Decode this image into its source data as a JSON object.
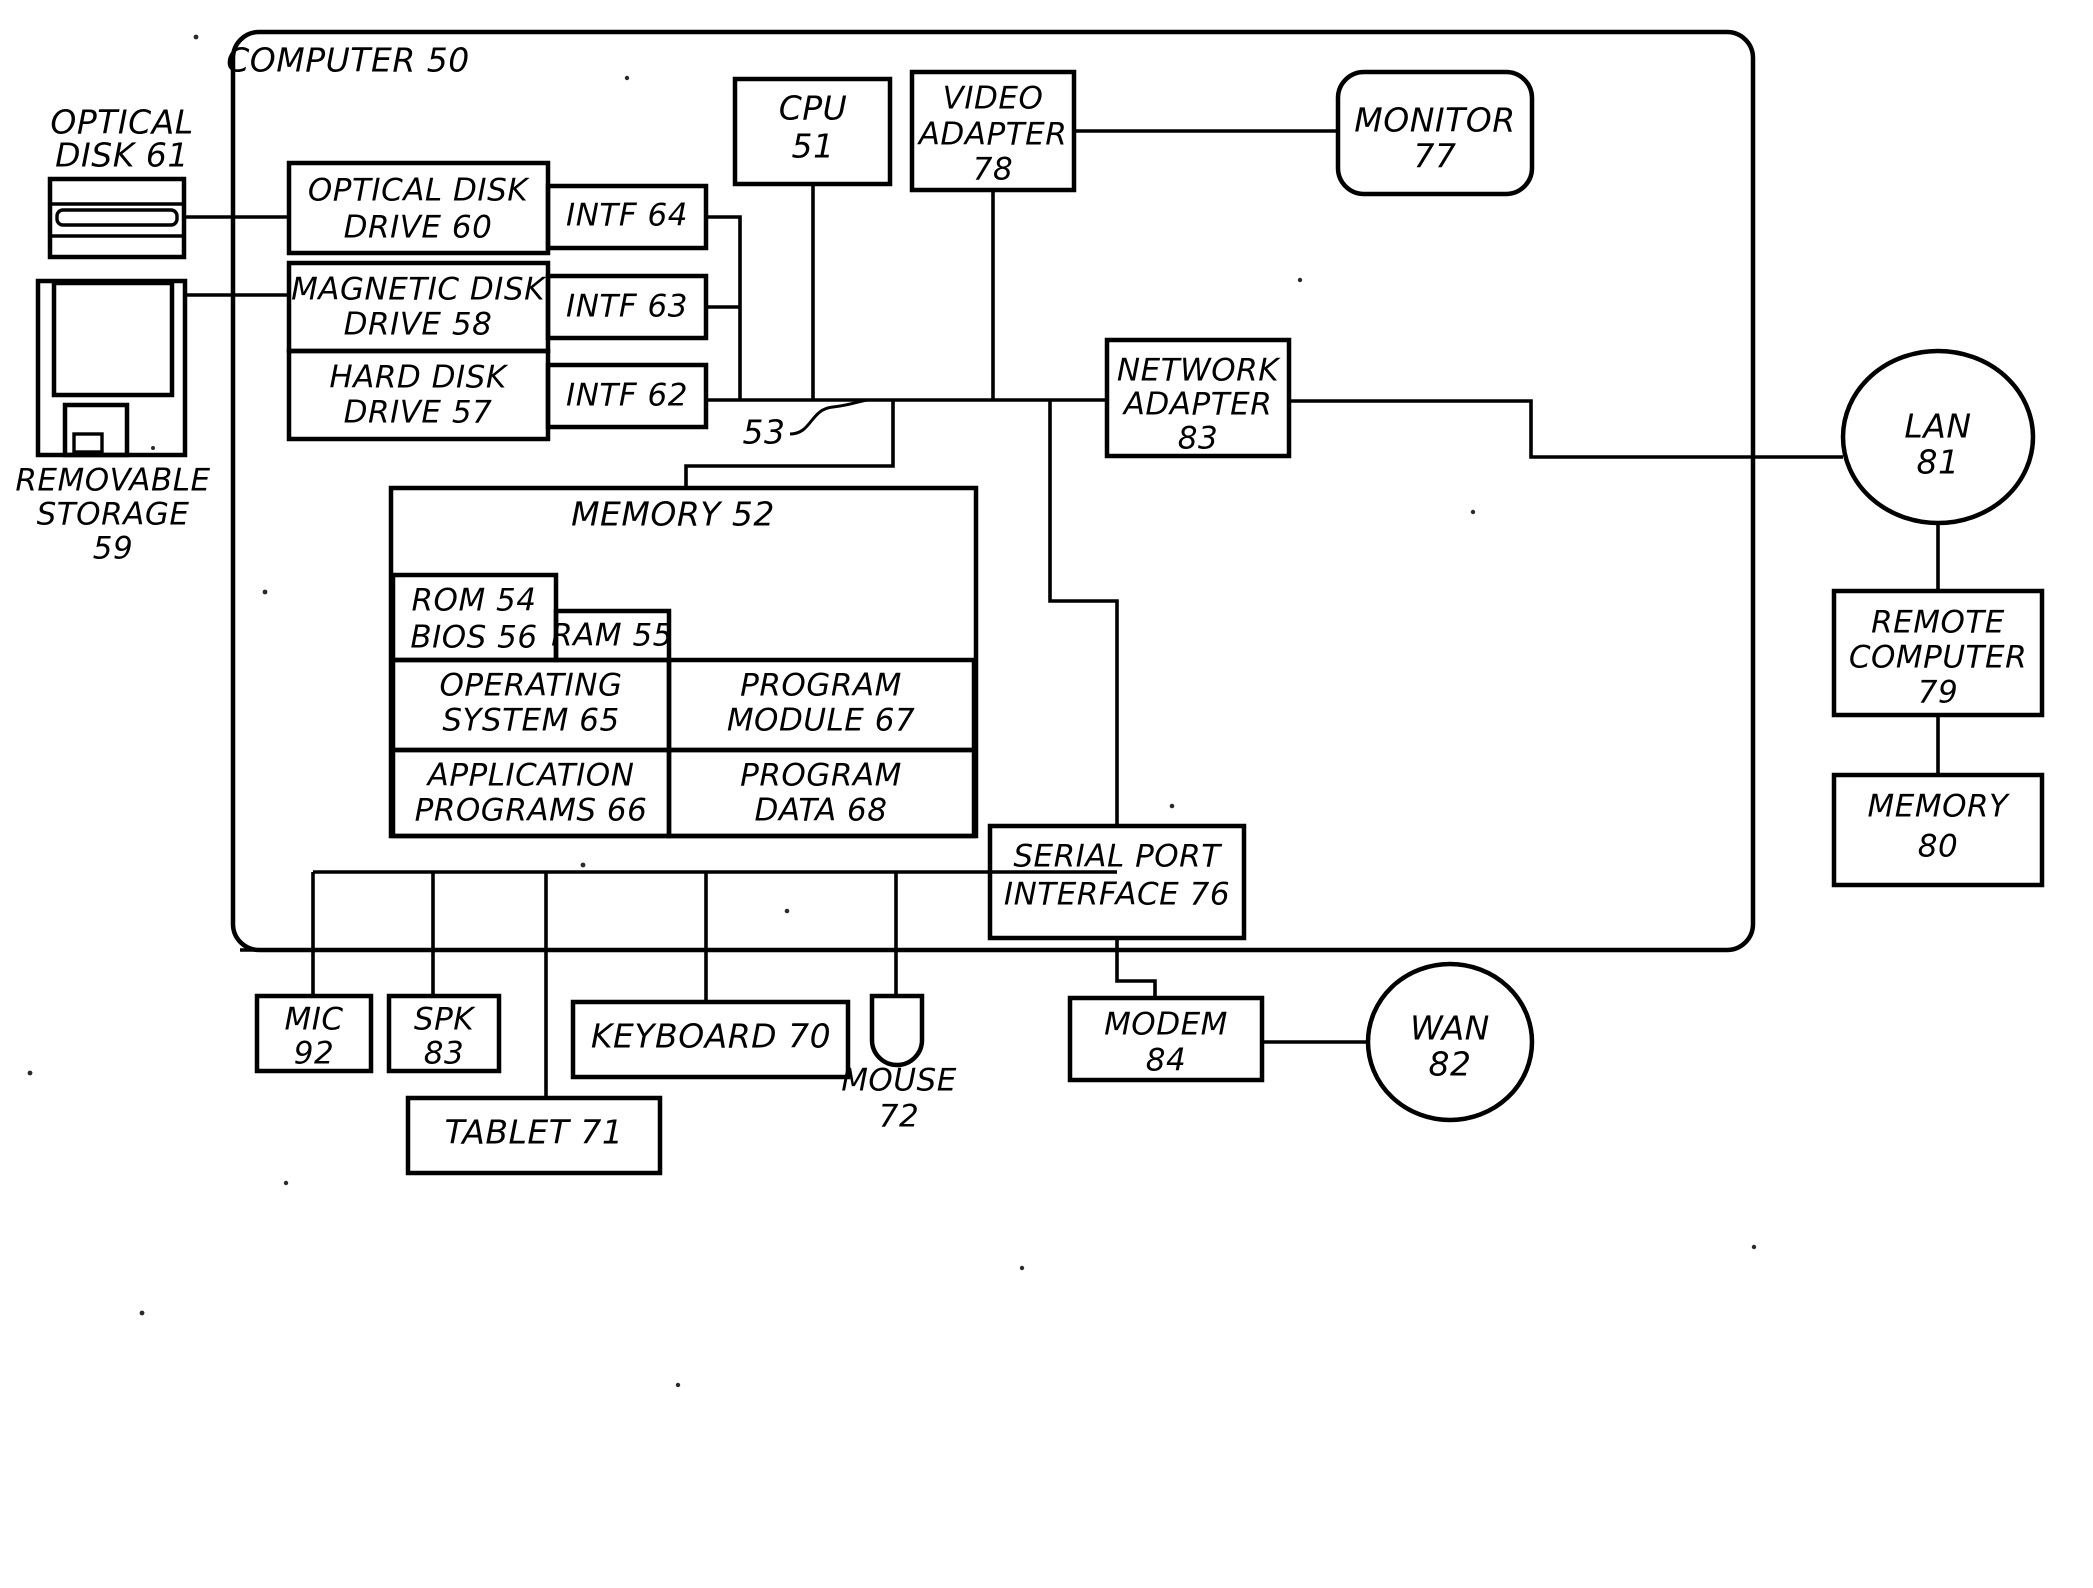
{
  "diagram": {
    "title": "Computer system block diagram",
    "outer_label": "COMPUTER 50",
    "bus_label": "53",
    "blocks": {
      "optical_disk": "OPTICAL\nDISK 61",
      "optical_disk_l1": "OPTICAL",
      "optical_disk_l2": "DISK 61",
      "removable_storage_l1": "REMOVABLE",
      "removable_storage_l2": "STORAGE",
      "removable_storage_l3": "59",
      "optical_disk_drive_l1": "OPTICAL DISK",
      "optical_disk_drive_l2": "DRIVE 60",
      "magnetic_disk_drive_l1": "MAGNETIC DISK",
      "magnetic_disk_drive_l2": "DRIVE 58",
      "hard_disk_drive_l1": "HARD DISK",
      "hard_disk_drive_l2": "DRIVE 57",
      "intf64": "INTF 64",
      "intf63": "INTF 63",
      "intf62": "INTF 62",
      "cpu_l1": "CPU",
      "cpu_l2": "51",
      "video_adapter_l1": "VIDEO",
      "video_adapter_l2": "ADAPTER",
      "video_adapter_l3": "78",
      "monitor_l1": "MONITOR",
      "monitor_l2": "77",
      "network_adapter_l1": "NETWORK",
      "network_adapter_l2": "ADAPTER",
      "network_adapter_l3": "83",
      "lan_l1": "LAN",
      "lan_l2": "81",
      "remote_computer_l1": "REMOTE",
      "remote_computer_l2": "COMPUTER",
      "remote_computer_l3": "79",
      "remote_memory_l1": "MEMORY",
      "remote_memory_l2": "80",
      "memory": "MEMORY 52",
      "rom": "ROM 54",
      "bios": "BIOS 56",
      "ram": "RAM 55",
      "operating_system_l1": "OPERATING",
      "operating_system_l2": "SYSTEM 65",
      "program_module_l1": "PROGRAM",
      "program_module_l2": "MODULE 67",
      "application_programs_l1": "APPLICATION",
      "application_programs_l2": "PROGRAMS 66",
      "program_data_l1": "PROGRAM",
      "program_data_l2": "DATA 68",
      "serial_port_l1": "SERIAL PORT",
      "serial_port_l2": "INTERFACE 76",
      "mic_l1": "MIC",
      "mic_l2": "92",
      "spk_l1": "SPK",
      "spk_l2": "83",
      "keyboard": "KEYBOARD 70",
      "tablet": "TABLET 71",
      "mouse_l1": "MOUSE",
      "mouse_l2": "72",
      "modem_l1": "MODEM",
      "modem_l2": "84",
      "wan_l1": "WAN",
      "wan_l2": "82"
    },
    "colors": {
      "stroke": "#000000",
      "background": "#ffffff"
    }
  }
}
